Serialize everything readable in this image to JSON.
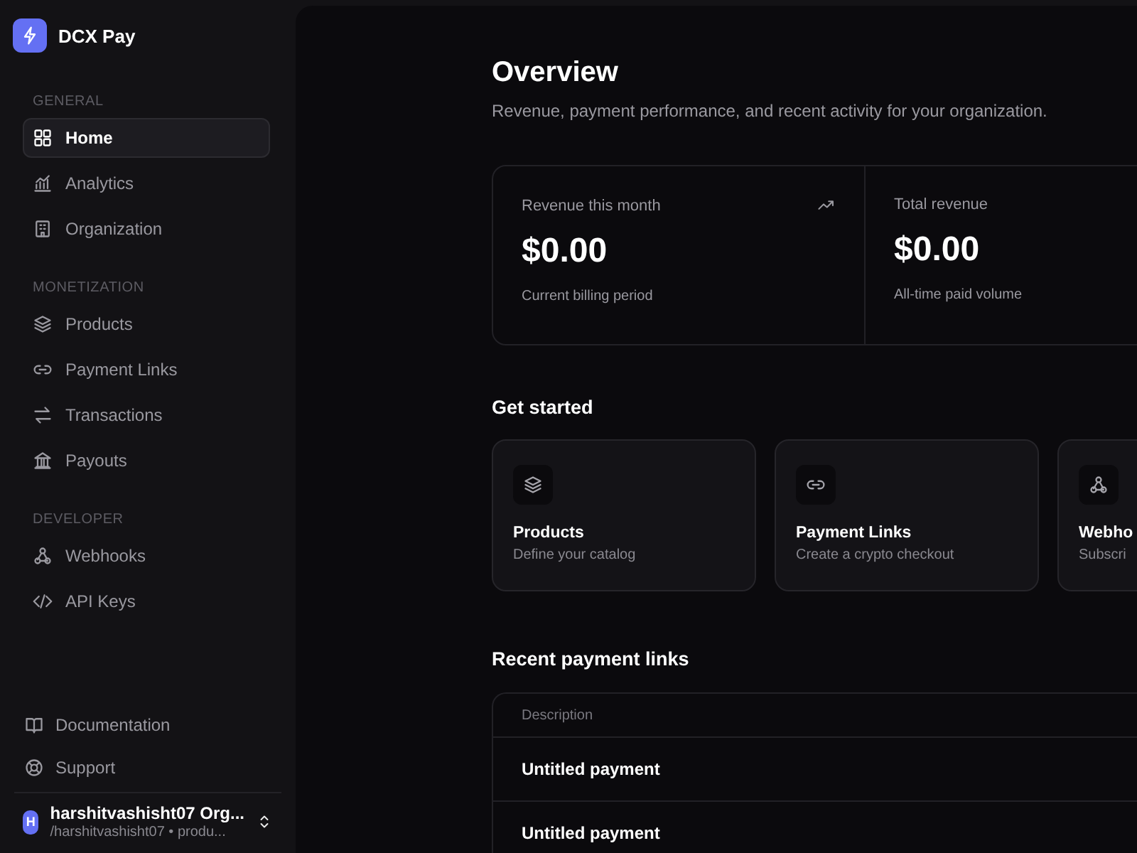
{
  "brand": {
    "name": "DCX Pay"
  },
  "sidebar": {
    "sections": [
      {
        "label": "GENERAL",
        "items": [
          {
            "label": "Home",
            "selected": true
          },
          {
            "label": "Analytics",
            "selected": false
          },
          {
            "label": "Organization",
            "selected": false
          }
        ]
      },
      {
        "label": "MONETIZATION",
        "items": [
          {
            "label": "Products",
            "selected": false
          },
          {
            "label": "Payment Links",
            "selected": false
          },
          {
            "label": "Transactions",
            "selected": false
          },
          {
            "label": "Payouts",
            "selected": false
          }
        ]
      },
      {
        "label": "DEVELOPER",
        "items": [
          {
            "label": "Webhooks",
            "selected": false
          },
          {
            "label": "API Keys",
            "selected": false
          }
        ]
      }
    ],
    "footer_links": [
      {
        "label": "Documentation"
      },
      {
        "label": "Support"
      }
    ],
    "account": {
      "avatar": "H",
      "name": "harshitvashisht07 Org...",
      "path": "/harshitvashisht07 • produ..."
    }
  },
  "page": {
    "title": "Overview",
    "subtitle": "Revenue, payment performance, and recent activity for your organization."
  },
  "stats": [
    {
      "label": "Revenue this month",
      "value": "$0.00",
      "caption": "Current billing period",
      "trend_icon": true
    },
    {
      "label": "Total revenue",
      "value": "$0.00",
      "caption": "All-time paid volume",
      "trend_icon": false
    }
  ],
  "get_started": {
    "title": "Get started",
    "cards": [
      {
        "title": "Products",
        "description": "Define your catalog"
      },
      {
        "title": "Payment Links",
        "description": "Create a crypto checkout"
      },
      {
        "title": "Webho",
        "description": "Subscri"
      }
    ]
  },
  "recent_links": {
    "title": "Recent payment links",
    "columns": [
      "Description"
    ],
    "rows": [
      [
        "Untitled payment"
      ],
      [
        "Untitled payment"
      ]
    ]
  }
}
